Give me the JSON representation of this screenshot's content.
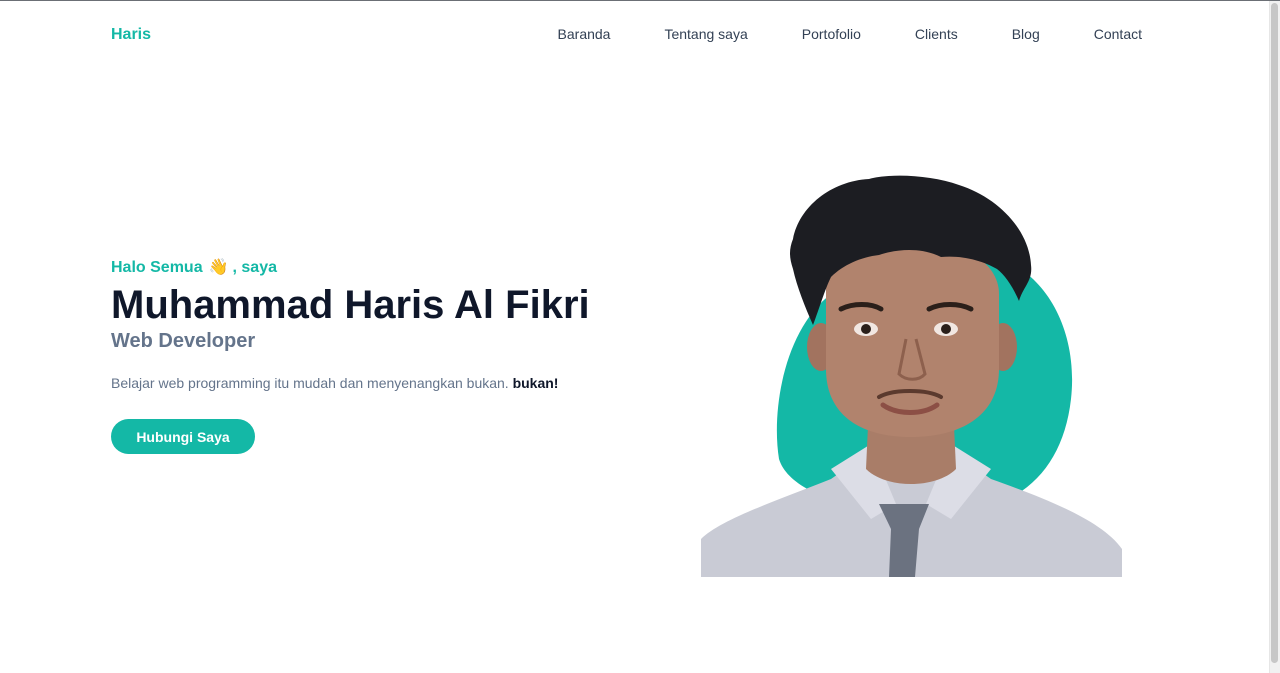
{
  "navbar": {
    "brand": "Haris",
    "links": [
      {
        "label": "Baranda"
      },
      {
        "label": "Tentang saya"
      },
      {
        "label": "Portofolio"
      },
      {
        "label": "Clients"
      },
      {
        "label": "Blog"
      },
      {
        "label": "Contact"
      }
    ]
  },
  "hero": {
    "greeting_prefix": "Halo Semua",
    "greeting_emoji": "👋",
    "greeting_suffix": ", saya",
    "name": "Muhammad Haris Al Fikri",
    "role": "Web Developer",
    "description_prefix": "Belajar web programming itu mudah dan menyenangkan bukan.",
    "description_emphasis": "bukan!",
    "cta_label": "Hubungi Saya"
  },
  "colors": {
    "accent": "#14b8a6",
    "heading": "#0f172a",
    "muted": "#64748b"
  },
  "icons": {
    "greeting": "waving-hand-icon"
  }
}
